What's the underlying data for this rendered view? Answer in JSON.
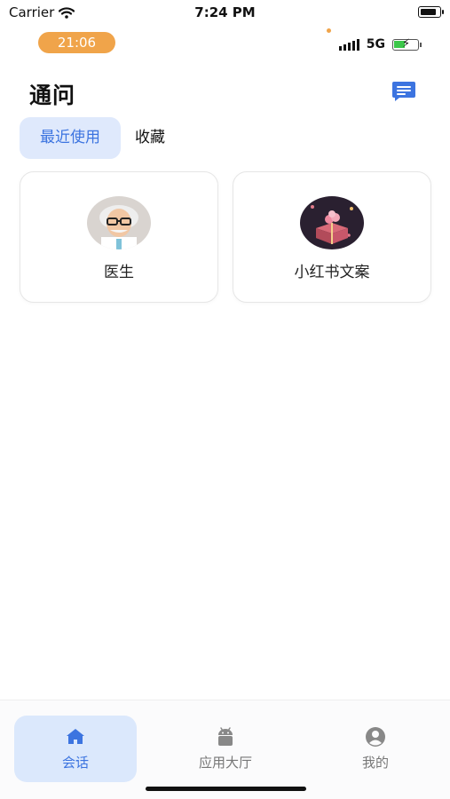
{
  "ios_status": {
    "carrier": "Carrier",
    "time": "7:24 PM"
  },
  "device_status": {
    "time": "21:06",
    "network": "5G"
  },
  "header": {
    "title": "通问",
    "chat_icon": "message-icon"
  },
  "tabs": [
    {
      "label": "最近使用",
      "active": true
    },
    {
      "label": "收藏",
      "active": false
    }
  ],
  "cards": [
    {
      "label": "医生",
      "icon": "doctor-avatar"
    },
    {
      "label": "小红书文案",
      "icon": "gift-box-avatar"
    }
  ],
  "bottom_nav": [
    {
      "label": "会话",
      "icon": "home-icon",
      "active": true
    },
    {
      "label": "应用大厅",
      "icon": "android-icon",
      "active": false
    },
    {
      "label": "我的",
      "icon": "user-icon",
      "active": false
    }
  ],
  "colors": {
    "accent": "#3c74e0",
    "accent_bg": "#dfe9fc",
    "time_pill": "#f0a44a"
  }
}
